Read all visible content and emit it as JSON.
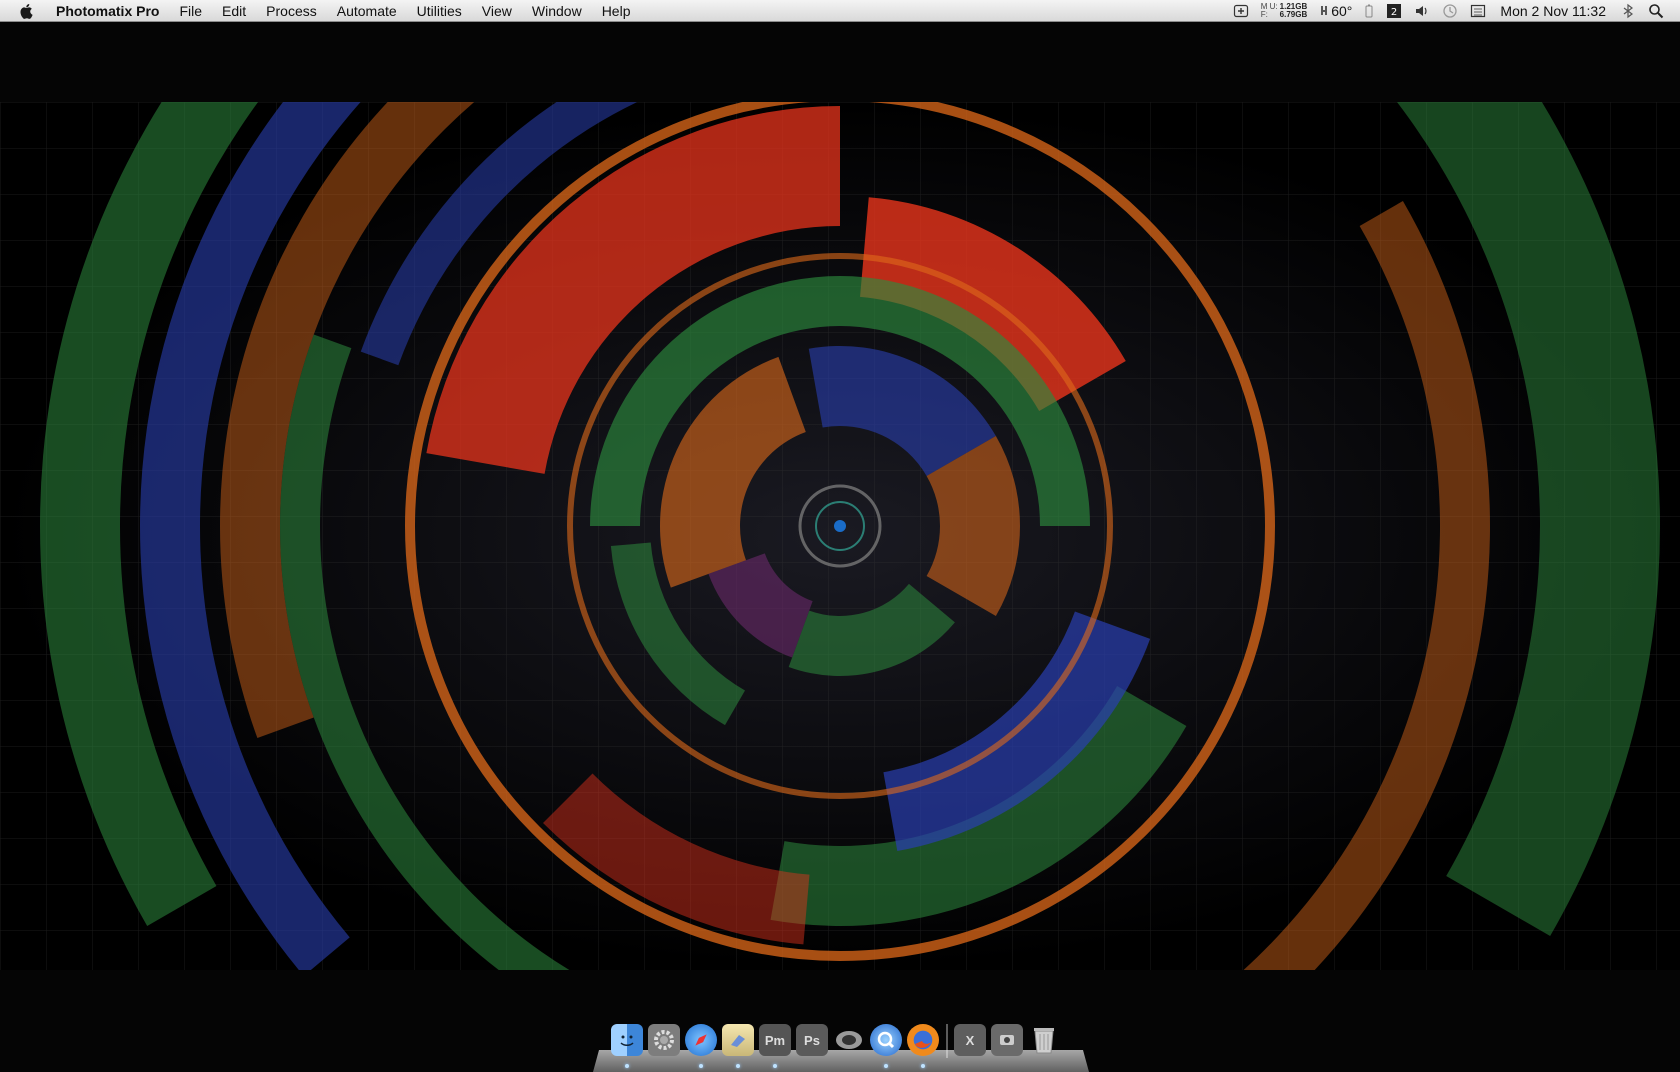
{
  "menubar": {
    "app_name": "Photomatix Pro",
    "menus": [
      "File",
      "Edit",
      "Process",
      "Automate",
      "Utilities",
      "View",
      "Window",
      "Help"
    ],
    "status": {
      "memory_labels": [
        "M U:",
        "F:"
      ],
      "memory_used": "1.21GB",
      "memory_free": "6.79GB",
      "temperature": "60°",
      "clock": "Mon 2 Nov  11:32"
    },
    "icons": [
      "add-icon",
      "memory-icon",
      "temperature-icon",
      "battery-icon",
      "calendar-icon",
      "volume-icon",
      "time-machine-icon",
      "keyboard-icon",
      "bluetooth-icon",
      "spotlight-icon"
    ]
  },
  "dock": {
    "items": [
      {
        "name": "finder",
        "label": ""
      },
      {
        "name": "system-preferences",
        "label": ""
      },
      {
        "name": "safari",
        "label": ""
      },
      {
        "name": "mail",
        "label": ""
      },
      {
        "name": "photomatix",
        "label": "Pm"
      },
      {
        "name": "photoshop",
        "label": "Ps"
      },
      {
        "name": "aperture",
        "label": ""
      },
      {
        "name": "quicktime",
        "label": ""
      },
      {
        "name": "firefox",
        "label": ""
      },
      {
        "name": "x11",
        "label": "X"
      },
      {
        "name": "utility",
        "label": ""
      },
      {
        "name": "trash",
        "label": ""
      }
    ]
  },
  "colors": {
    "menubar_bg": "#e4e4e4",
    "desktop_bg": "#050505",
    "wallpaper_red": "#e8341c",
    "wallpaper_green": "#2d8a3e",
    "wallpaper_blue": "#2a3fb0",
    "wallpaper_orange": "#e06a1a"
  }
}
